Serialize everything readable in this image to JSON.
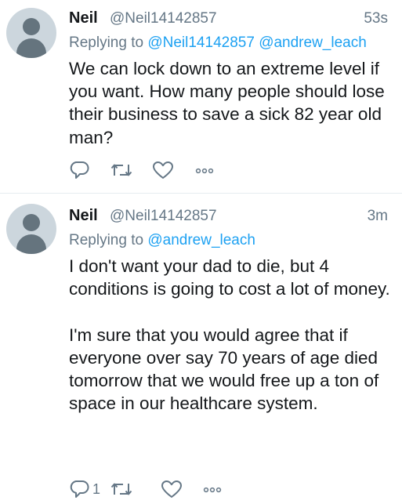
{
  "tweets": [
    {
      "name": "Neil",
      "handle": "@Neil14142857",
      "time": "53s",
      "replying_prefix": "Replying to",
      "mentions": [
        "@Neil14142857",
        "@andrew_leach"
      ],
      "text": "We can lock down to an extreme level if you want.  How many people should lose their business to save a sick 82 year old man?",
      "reply_count": ""
    },
    {
      "name": "Neil",
      "handle": "@Neil14142857",
      "time": "3m",
      "replying_prefix": "Replying to",
      "mentions": [
        "@andrew_leach"
      ],
      "text": "I don't want your dad to die, but 4 conditions is going to cost a lot of money.\n\nI'm sure that you would agree that if everyone over say 70 years of age died tomorrow that we would free up a ton of space in our healthcare system.",
      "reply_count": "1"
    }
  ],
  "icons": [
    "reply-icon",
    "retweet-icon",
    "like-icon",
    "more-icon"
  ],
  "colors": {
    "text": "#14171a",
    "muted": "#657786",
    "link": "#1da1f2",
    "avatar_bg": "#ccd6dd",
    "avatar_fg": "#65747e",
    "divider": "#e6ecf0"
  }
}
